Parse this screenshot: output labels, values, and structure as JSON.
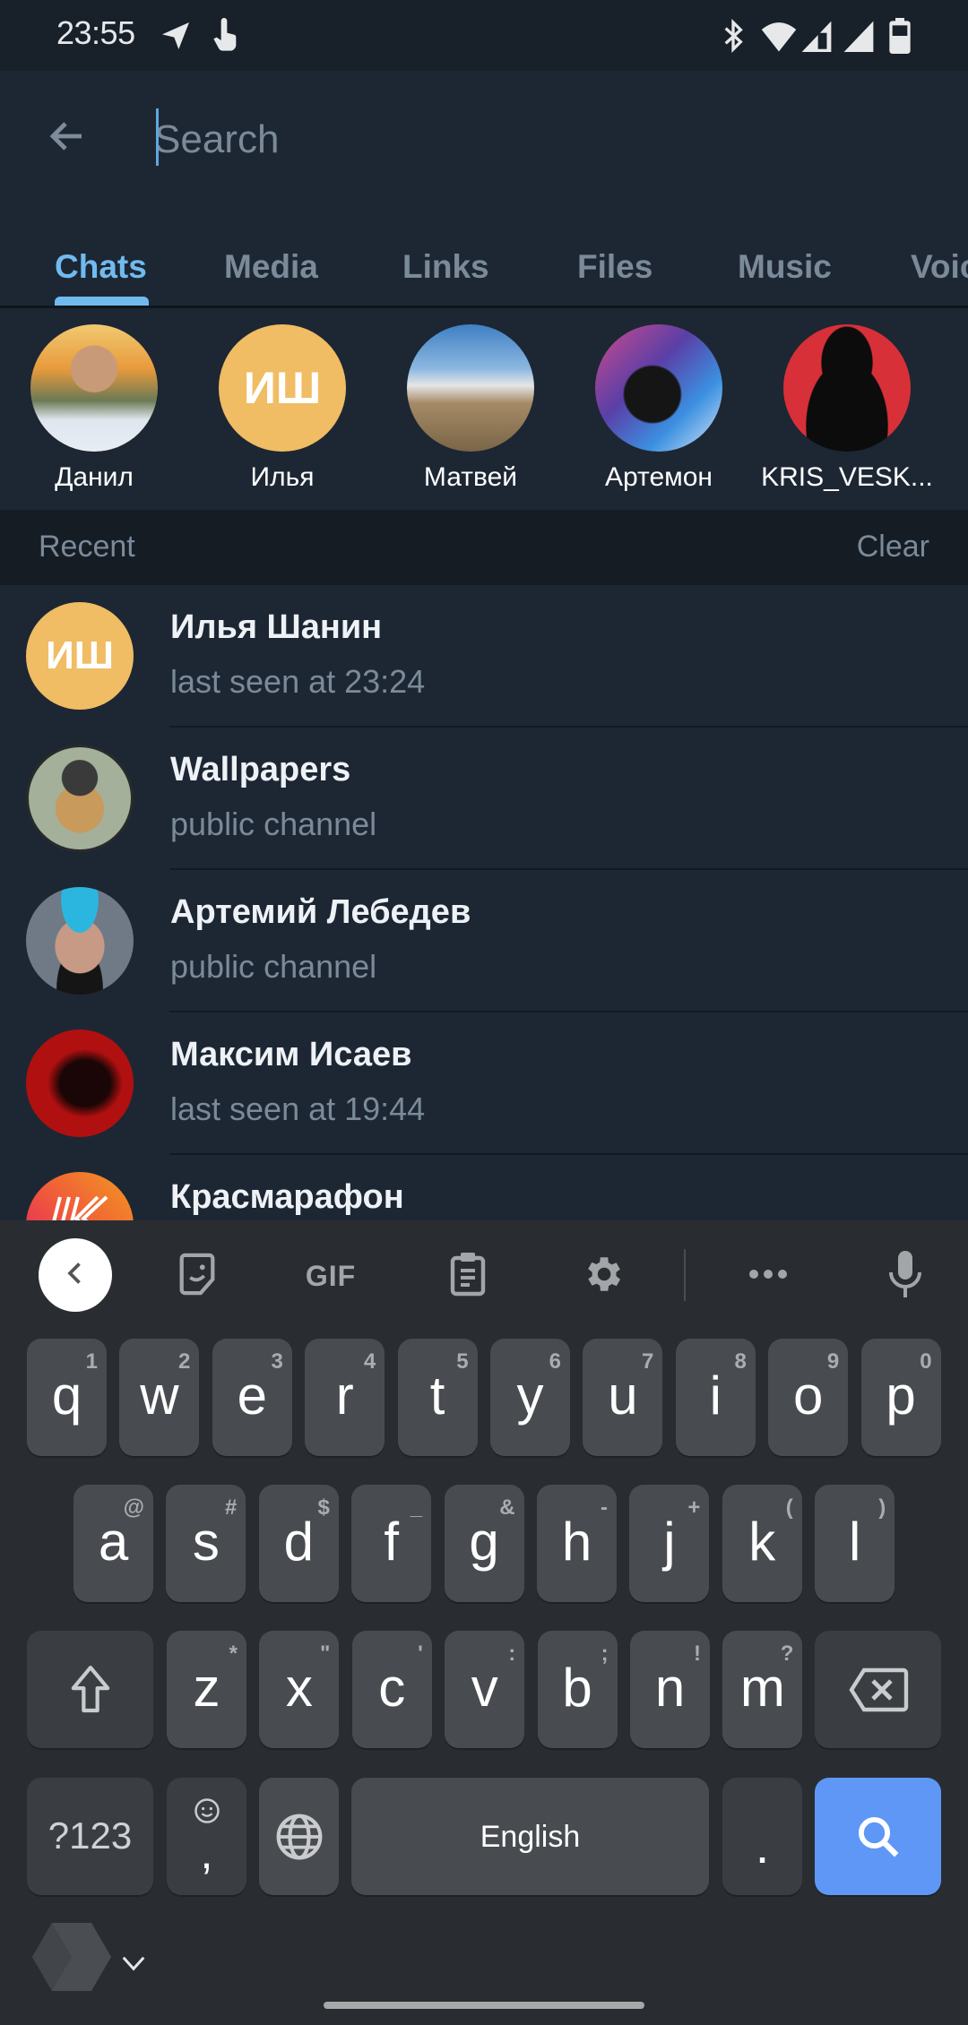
{
  "status_bar": {
    "time": "23:55",
    "left_icons": [
      "telegram-icon",
      "touch-icon"
    ],
    "right_icons": [
      "bluetooth-icon",
      "wifi-icon",
      "signal-1-icon",
      "signal-2-icon",
      "battery-icon"
    ]
  },
  "search": {
    "placeholder": "Search",
    "value": "",
    "back_icon": "arrow-left-icon"
  },
  "tabs": [
    {
      "label": "Chats",
      "active": true
    },
    {
      "label": "Media",
      "active": false
    },
    {
      "label": "Links",
      "active": false
    },
    {
      "label": "Files",
      "active": false
    },
    {
      "label": "Music",
      "active": false
    },
    {
      "label": "Voice",
      "active": false
    }
  ],
  "top_people": [
    {
      "name": "Данил",
      "initials": "",
      "color": "#d9a25a"
    },
    {
      "name": "Илья",
      "initials": "ИШ",
      "color": "#f0bc64"
    },
    {
      "name": "Матвей",
      "initials": "",
      "color": "#6a9fd0"
    },
    {
      "name": "Артемон",
      "initials": "",
      "color": "#7b5bb5"
    },
    {
      "name": "KRIS_VESK...",
      "initials": "",
      "color": "#d83038"
    }
  ],
  "recent": {
    "title": "Recent",
    "clear_label": "Clear",
    "items": [
      {
        "title": "Илья Шанин",
        "subtitle": "last seen at 23:24",
        "initials": "ИШ",
        "color": "#f0bc64"
      },
      {
        "title": "Wallpapers",
        "subtitle": "public channel",
        "initials": "",
        "color": "#8a8f7a"
      },
      {
        "title": "Артемий Лебедев",
        "subtitle": "public channel",
        "initials": "",
        "color": "#6f7a86"
      },
      {
        "title": "Максим Исаев",
        "subtitle": "last seen at 19:44",
        "initials": "",
        "color": "#b01010"
      },
      {
        "title": "Красмарафон",
        "subtitle": "",
        "initials": "",
        "color": "#ee4a3a"
      }
    ]
  },
  "keyboard": {
    "toolbar": [
      "collapse-icon",
      "sticker-icon",
      "GIF",
      "clipboard-icon",
      "settings-icon",
      "more-icon",
      "microphone-icon"
    ],
    "row1": [
      {
        "k": "q",
        "h": "1"
      },
      {
        "k": "w",
        "h": "2"
      },
      {
        "k": "e",
        "h": "3"
      },
      {
        "k": "r",
        "h": "4"
      },
      {
        "k": "t",
        "h": "5"
      },
      {
        "k": "y",
        "h": "6"
      },
      {
        "k": "u",
        "h": "7"
      },
      {
        "k": "i",
        "h": "8"
      },
      {
        "k": "o",
        "h": "9"
      },
      {
        "k": "p",
        "h": "0"
      }
    ],
    "row2": [
      {
        "k": "a",
        "h": "@"
      },
      {
        "k": "s",
        "h": "#"
      },
      {
        "k": "d",
        "h": "$"
      },
      {
        "k": "f",
        "h": "_"
      },
      {
        "k": "g",
        "h": "&"
      },
      {
        "k": "h",
        "h": "-"
      },
      {
        "k": "j",
        "h": "+"
      },
      {
        "k": "k",
        "h": "("
      },
      {
        "k": "l",
        "h": ")"
      }
    ],
    "row3": [
      {
        "k": "z",
        "h": "*"
      },
      {
        "k": "x",
        "h": "\""
      },
      {
        "k": "c",
        "h": "'"
      },
      {
        "k": "v",
        "h": ":"
      },
      {
        "k": "b",
        "h": ";"
      },
      {
        "k": "n",
        "h": "!"
      },
      {
        "k": "m",
        "h": "?"
      }
    ],
    "symbols_label": "?123",
    "comma": ",",
    "space_label": "English",
    "period": ".",
    "action": "search-icon"
  }
}
